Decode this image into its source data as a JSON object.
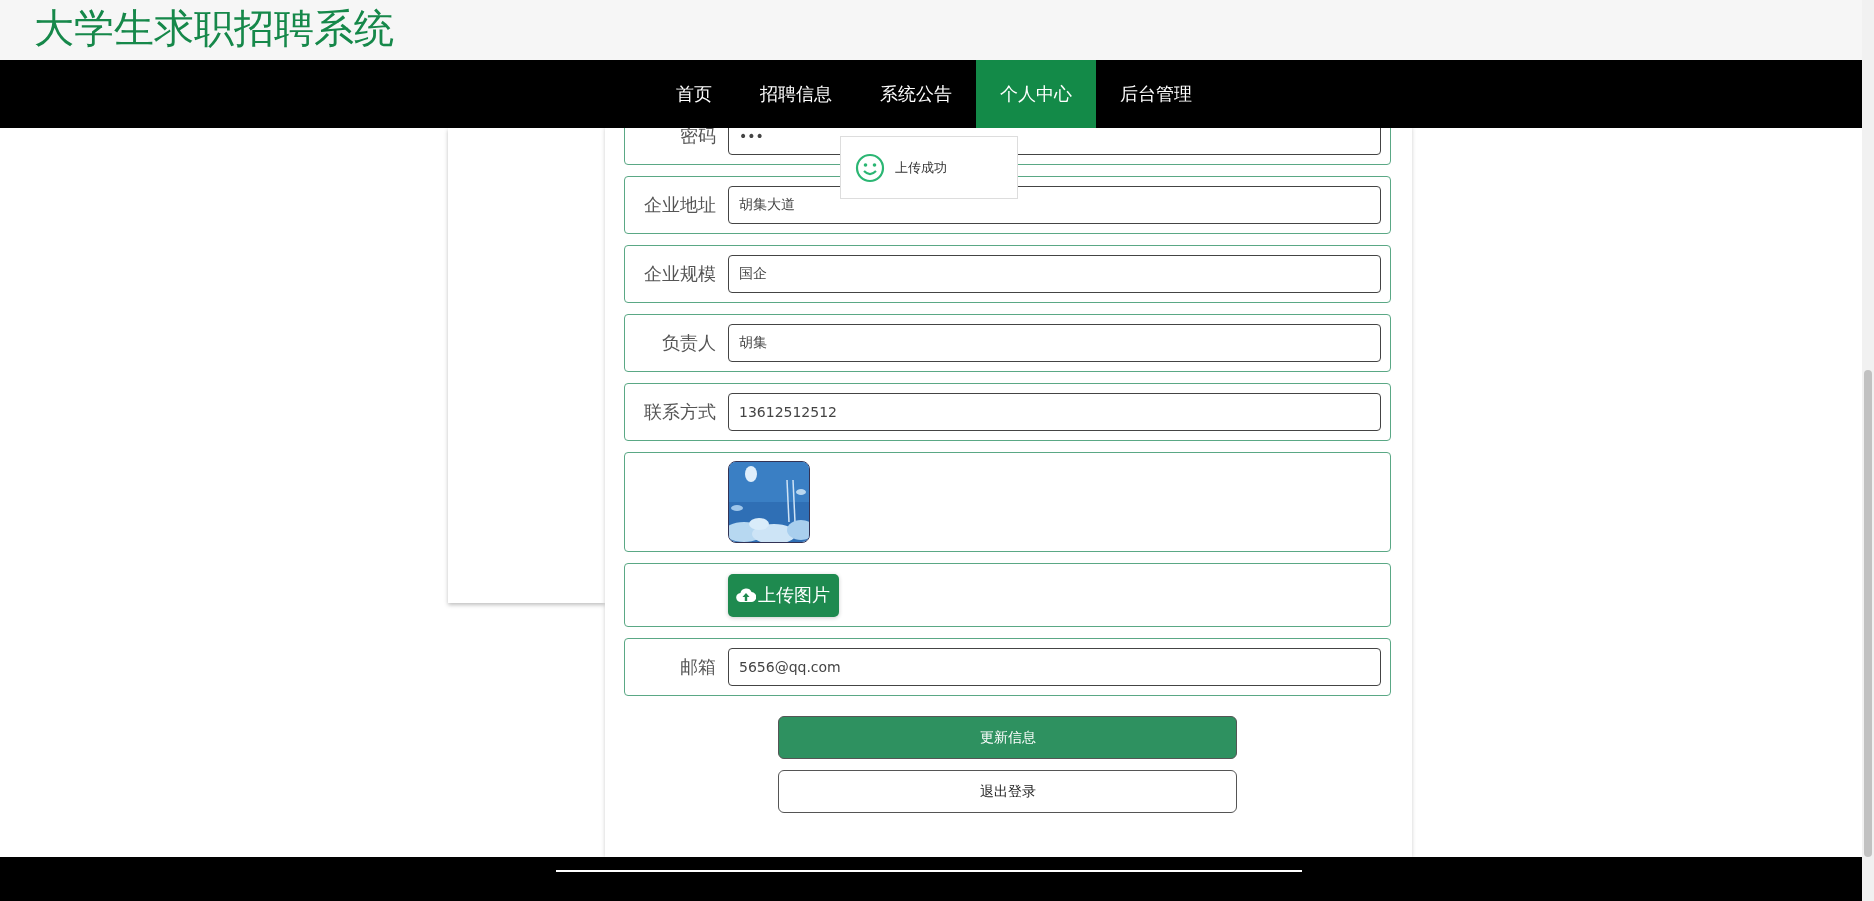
{
  "site_title": "大学生求职招聘系统",
  "nav": [
    {
      "label": "首页",
      "selected": false
    },
    {
      "label": "招聘信息",
      "selected": false
    },
    {
      "label": "系统公告",
      "selected": false
    },
    {
      "label": "个人中心",
      "selected": true
    },
    {
      "label": "后台管理",
      "selected": false
    }
  ],
  "toast": {
    "message": "上传成功"
  },
  "form": {
    "rows": [
      {
        "kind": "field",
        "label": "密码",
        "value": "•••"
      },
      {
        "kind": "field",
        "label": "企业地址",
        "value": "胡集大道"
      },
      {
        "kind": "field",
        "label": "企业规模",
        "value": "国企"
      },
      {
        "kind": "field",
        "label": "负责人",
        "value": "胡集"
      },
      {
        "kind": "field",
        "label": "联系方式",
        "value": "13612512512"
      },
      {
        "kind": "picture"
      },
      {
        "kind": "upload",
        "label": "上传图片"
      },
      {
        "kind": "field",
        "label": "邮箱",
        "value": "5656@qq.com"
      }
    ]
  },
  "buttons": [
    {
      "label": "更新信息",
      "kind": "primary"
    },
    {
      "label": "退出登录",
      "kind": "secondary"
    }
  ]
}
